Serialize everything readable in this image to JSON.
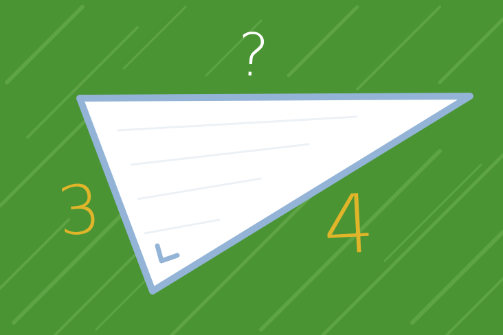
{
  "labels": {
    "hypotenuse": "?",
    "leg_a": "3",
    "leg_b": "4"
  },
  "colors": {
    "board": "#4a9434",
    "stroke_texture": "#6fb156",
    "triangle_fill": "#ffffff",
    "triangle_edge": "#93b4d6",
    "leg_label": "#e0b52a",
    "question_mark": "#ffffff"
  }
}
